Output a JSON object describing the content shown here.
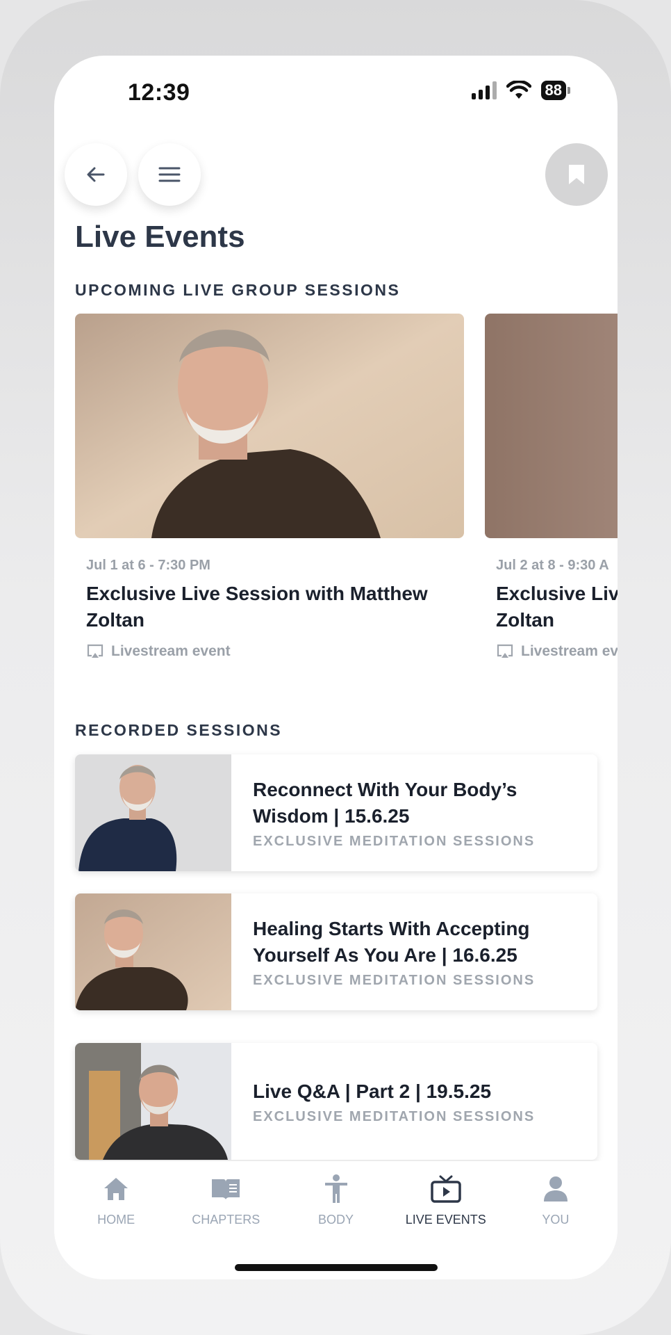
{
  "status_bar": {
    "time": "12:39",
    "battery": "88"
  },
  "page": {
    "title": "Live Events"
  },
  "upcoming": {
    "section_title": "UPCOMING LIVE GROUP SESSIONS",
    "events": [
      {
        "date": "Jul 1 at 6 - 7:30 PM",
        "title": "Exclusive Live Session with Matthew Zoltan",
        "type": "Livestream event"
      },
      {
        "date": "Jul 2 at 8 - 9:30 A",
        "title": "Exclusive Live Session with Matthew Zoltan",
        "type": "Livestream ev"
      }
    ]
  },
  "recorded": {
    "section_title": "RECORDED SESSIONS",
    "items": [
      {
        "title": "Reconnect With Your Body’s Wisdom | 15.6.25",
        "category": "EXCLUSIVE MEDITATION SESSIONS"
      },
      {
        "title": "Healing Starts With Accepting Yourself As You Are | 16.6.25",
        "category": "EXCLUSIVE MEDITATION SESSIONS"
      },
      {
        "title": "Live Q&A | Part 2 | 19.5.25",
        "category": "EXCLUSIVE MEDITATION SESSIONS"
      }
    ]
  },
  "tab_bar": {
    "tabs": [
      {
        "label": "HOME",
        "icon": "home-icon"
      },
      {
        "label": "CHAPTERS",
        "icon": "book-icon"
      },
      {
        "label": "BODY",
        "icon": "body-icon"
      },
      {
        "label": "LIVE EVENTS",
        "icon": "tv-icon",
        "active": true
      },
      {
        "label": "YOU",
        "icon": "user-icon"
      }
    ]
  },
  "colors": {
    "heading": "#2d3748",
    "muted": "#9aa0a8",
    "bookmark_bg": "#d5d5d6"
  }
}
